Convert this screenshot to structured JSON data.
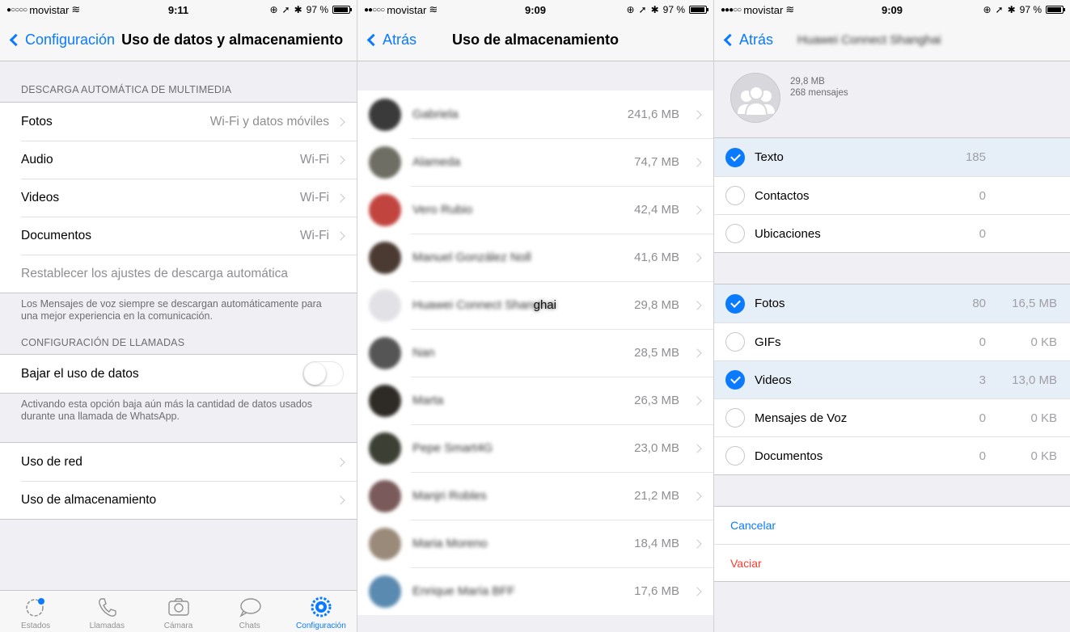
{
  "colors": {
    "accent": "#0a7aff",
    "destructive": "#ff3b30",
    "secondary_text": "#8e8e93",
    "background": "#efeff4"
  },
  "screen1": {
    "status": {
      "carrier": "movistar",
      "time": "9:11",
      "battery": "97 %"
    },
    "nav": {
      "back": "Configuración",
      "title": "Uso de datos y almacenamiento"
    },
    "auto_download": {
      "header": "DESCARGA AUTOMÁTICA DE MULTIMEDIA",
      "rows": [
        {
          "label": "Fotos",
          "value": "Wi-Fi y datos móviles"
        },
        {
          "label": "Audio",
          "value": "Wi-Fi"
        },
        {
          "label": "Videos",
          "value": "Wi-Fi"
        },
        {
          "label": "Documentos",
          "value": "Wi-Fi"
        }
      ],
      "reset": "Restablecer los ajustes de descarga automática",
      "footer": "Los Mensajes de voz siempre se descargan automáticamente para una mejor experiencia en la comunicación."
    },
    "calls": {
      "header": "CONFIGURACIÓN DE LLAMADAS",
      "toggle_label": "Bajar el uso de datos",
      "toggle_on": false,
      "footer": "Activando esta opción baja aún más la cantidad de datos usados durante una llamada de WhatsApp."
    },
    "usage": [
      "Uso de red",
      "Uso de almacenamiento"
    ],
    "tabs": [
      {
        "label": "Estados",
        "icon": "status-icon"
      },
      {
        "label": "Llamadas",
        "icon": "phone-icon"
      },
      {
        "label": "Cámara",
        "icon": "camera-icon"
      },
      {
        "label": "Chats",
        "icon": "chat-bubble-icon"
      },
      {
        "label": "Configuración",
        "icon": "gear-icon",
        "active": true
      }
    ]
  },
  "screen2": {
    "status": {
      "carrier": "movistar",
      "time": "9:09",
      "battery": "97 %"
    },
    "nav": {
      "back": "Atrás",
      "title": "Uso de almacenamiento"
    },
    "chats": [
      {
        "name": "Gabriela",
        "size": "241,6 MB",
        "color": "#3a3a3a"
      },
      {
        "name": "Alameda",
        "size": "74,7 MB",
        "color": "#6e6e64"
      },
      {
        "name": "Vero Rubio",
        "size": "42,4 MB",
        "color": "#c2443f"
      },
      {
        "name": "Manuel González Noll",
        "size": "41,6 MB",
        "color": "#4a3a32"
      },
      {
        "name": "Huawei Connect Shanghai",
        "size": "29,8 MB",
        "color": "#e2e2e6"
      },
      {
        "name": "Nan",
        "size": "28,5 MB",
        "color": "#555555"
      },
      {
        "name": "Marta",
        "size": "26,3 MB",
        "color": "#2e2a26"
      },
      {
        "name": "Pepe Smart4G",
        "size": "23,0 MB",
        "color": "#3c3f33"
      },
      {
        "name": "Manjri Robles",
        "size": "21,2 MB",
        "color": "#7a5a5a"
      },
      {
        "name": "Maria Moreno",
        "size": "18,4 MB",
        "color": "#9a8a7a"
      },
      {
        "name": "Enrique María BFF",
        "size": "17,6 MB",
        "color": "#5a8ab0"
      }
    ],
    "visible_name_suffix": "ghai"
  },
  "screen3": {
    "status": {
      "carrier": "movistar",
      "time": "9:09",
      "battery": "97 %"
    },
    "nav": {
      "back": "Atrás",
      "title": "Huawei Connect Shanghai"
    },
    "contact": {
      "size": "29,8 MB",
      "messages": "268 mensajes"
    },
    "group1": [
      {
        "label": "Texto",
        "count": "185",
        "size": "",
        "checked": true
      },
      {
        "label": "Contactos",
        "count": "0",
        "size": "",
        "checked": false
      },
      {
        "label": "Ubicaciones",
        "count": "0",
        "size": "",
        "checked": false
      }
    ],
    "group2": [
      {
        "label": "Fotos",
        "count": "80",
        "size": "16,5 MB",
        "checked": true
      },
      {
        "label": "GIFs",
        "count": "0",
        "size": "0 KB",
        "checked": false
      },
      {
        "label": "Videos",
        "count": "3",
        "size": "13,0 MB",
        "checked": true
      },
      {
        "label": "Mensajes de Voz",
        "count": "0",
        "size": "0 KB",
        "checked": false
      },
      {
        "label": "Documentos",
        "count": "0",
        "size": "0 KB",
        "checked": false
      }
    ],
    "actions": {
      "cancel": "Cancelar",
      "empty": "Vaciar"
    }
  }
}
